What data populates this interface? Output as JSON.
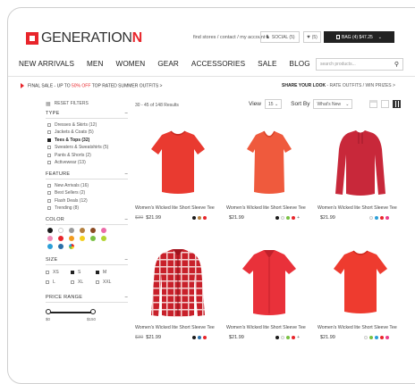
{
  "header": {
    "logo_main": "GENERATION",
    "logo_accent": "N",
    "top_links": "find stores  /  contact  /  my account",
    "social_label": "SOCIAL (5)",
    "wishlist_label": "(5)",
    "bag_label": "BAG (4)  $47.25"
  },
  "nav": {
    "items": [
      "NEW ARRIVALS",
      "MEN",
      "WOMEN",
      "GEAR",
      "ACCESSORIES",
      "SALE",
      "BLOG"
    ],
    "search_placeholder": "search products..."
  },
  "promo": {
    "left_prefix": "FINAL SALE - UP TO ",
    "left_highlight": "50% OFF",
    "left_suffix": " TOP RATED SUMMER OUTFITS  >",
    "right_bold": "SHARE YOUR LOOK",
    "right_rest": "  -  RATE OUTFITS / WIN PRIZES  >"
  },
  "filters": {
    "reset": "RESET FILTERS",
    "type": {
      "title": "TYPE",
      "items": [
        {
          "label": "Dresses & Skirts (12)",
          "checked": false
        },
        {
          "label": "Jackets & Coats (5)",
          "checked": false
        },
        {
          "label": "Tees & Tops (32)",
          "checked": true
        },
        {
          "label": "Sweaters & Sweatshirts (5)",
          "checked": false
        },
        {
          "label": "Pants & Shorts (2)",
          "checked": false
        },
        {
          "label": "Activewear (13)",
          "checked": false
        }
      ]
    },
    "feature": {
      "title": "FEATURE",
      "items": [
        {
          "label": "New Arrivals (16)"
        },
        {
          "label": "Best Sellers (2)"
        },
        {
          "label": "Flash Deals (12)"
        },
        {
          "label": "Trending (8)"
        }
      ]
    },
    "color": {
      "title": "COLOR",
      "row1": [
        "#1a1a1a",
        "#ffffff",
        "#9a9a9a",
        "#b5813f",
        "#8b4a22",
        "#ec6aa8"
      ],
      "row2": [
        "#f08bb8",
        "#e8252b",
        "#f39a1e",
        "#f4cf1e",
        "#79c043",
        "#b2d432"
      ],
      "row3": [
        "#2b9fd8",
        "#2a6fa8",
        "#multicolor"
      ]
    },
    "size": {
      "title": "SIZE",
      "items": [
        {
          "label": "XS",
          "checked": false
        },
        {
          "label": "S",
          "checked": true
        },
        {
          "label": "M",
          "checked": true
        },
        {
          "label": "L",
          "checked": false
        },
        {
          "label": "XL",
          "checked": false
        },
        {
          "label": "XXL",
          "checked": false
        }
      ]
    },
    "price": {
      "title": "PRICE RANGE",
      "min": "$0",
      "max": "$150"
    }
  },
  "results": {
    "count": "30 - 45 of 148 Results",
    "view_label": "View",
    "view_value": "15",
    "sort_label": "Sort By",
    "sort_value": "What's New"
  },
  "products": [
    {
      "name": "Women's Wicked lite Short Sleeve Tee",
      "old_price": "$30",
      "price": "$21.99",
      "colors": [
        "#1a1a1a",
        "#b5813f",
        "#e8252b"
      ],
      "plus": ""
    },
    {
      "name": "Women's Wicked lite Short Sleeve Tee",
      "old_price": "",
      "price": "$21.99",
      "colors": [
        "#1a1a1a",
        "#ffffff",
        "#79c043",
        "#e8252b"
      ],
      "plus": "+"
    },
    {
      "name": "Women's Wicked lite Short Sleeve Tee",
      "old_price": "",
      "price": "$21.99",
      "colors": [
        "#ffffff",
        "#2b9fd8",
        "#e8252b",
        "#ec3f8a"
      ],
      "plus": ""
    },
    {
      "name": "Women's Wicked lite Short Sleeve Tee",
      "old_price": "$30",
      "price": "$21.99",
      "colors": [
        "#1a1a1a",
        "#2a6fa8",
        "#e8252b"
      ],
      "plus": ""
    },
    {
      "name": "Women's Wicked lite Short Sleeve Tee",
      "old_price": "",
      "price": "$21.99",
      "colors": [
        "#1a1a1a",
        "#ffffff",
        "#79c043",
        "#e8252b"
      ],
      "plus": "+"
    },
    {
      "name": "Women's Wicked lite Short Sleeve Tee",
      "old_price": "",
      "price": "$21.99",
      "colors": [
        "#ffffff",
        "#79c043",
        "#2b9fd8",
        "#e8252b",
        "#ec3f8a"
      ],
      "plus": ""
    }
  ]
}
